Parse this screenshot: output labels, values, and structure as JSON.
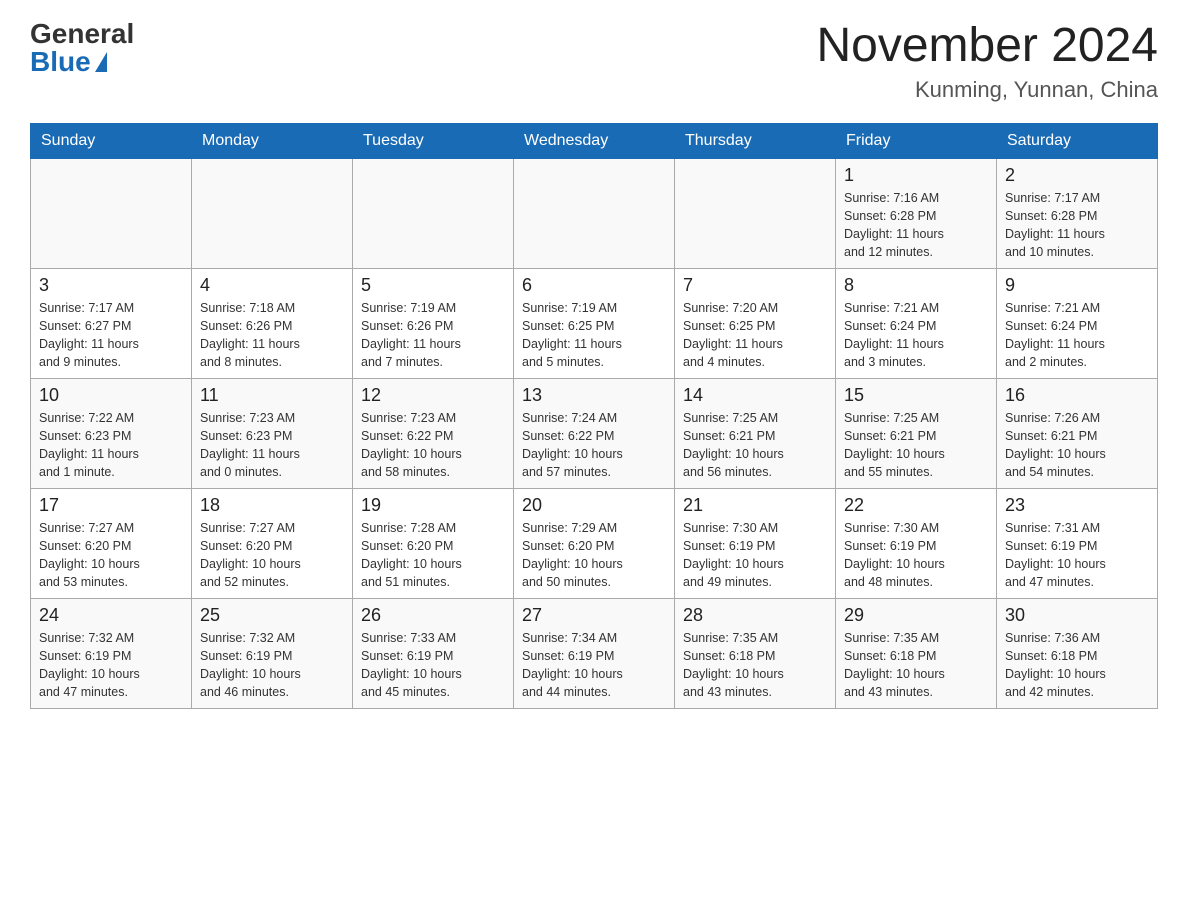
{
  "header": {
    "logo_general": "General",
    "logo_blue": "Blue",
    "month_title": "November 2024",
    "location": "Kunming, Yunnan, China"
  },
  "days_of_week": [
    "Sunday",
    "Monday",
    "Tuesday",
    "Wednesday",
    "Thursday",
    "Friday",
    "Saturday"
  ],
  "weeks": [
    [
      {
        "day": "",
        "info": ""
      },
      {
        "day": "",
        "info": ""
      },
      {
        "day": "",
        "info": ""
      },
      {
        "day": "",
        "info": ""
      },
      {
        "day": "",
        "info": ""
      },
      {
        "day": "1",
        "info": "Sunrise: 7:16 AM\nSunset: 6:28 PM\nDaylight: 11 hours\nand 12 minutes."
      },
      {
        "day": "2",
        "info": "Sunrise: 7:17 AM\nSunset: 6:28 PM\nDaylight: 11 hours\nand 10 minutes."
      }
    ],
    [
      {
        "day": "3",
        "info": "Sunrise: 7:17 AM\nSunset: 6:27 PM\nDaylight: 11 hours\nand 9 minutes."
      },
      {
        "day": "4",
        "info": "Sunrise: 7:18 AM\nSunset: 6:26 PM\nDaylight: 11 hours\nand 8 minutes."
      },
      {
        "day": "5",
        "info": "Sunrise: 7:19 AM\nSunset: 6:26 PM\nDaylight: 11 hours\nand 7 minutes."
      },
      {
        "day": "6",
        "info": "Sunrise: 7:19 AM\nSunset: 6:25 PM\nDaylight: 11 hours\nand 5 minutes."
      },
      {
        "day": "7",
        "info": "Sunrise: 7:20 AM\nSunset: 6:25 PM\nDaylight: 11 hours\nand 4 minutes."
      },
      {
        "day": "8",
        "info": "Sunrise: 7:21 AM\nSunset: 6:24 PM\nDaylight: 11 hours\nand 3 minutes."
      },
      {
        "day": "9",
        "info": "Sunrise: 7:21 AM\nSunset: 6:24 PM\nDaylight: 11 hours\nand 2 minutes."
      }
    ],
    [
      {
        "day": "10",
        "info": "Sunrise: 7:22 AM\nSunset: 6:23 PM\nDaylight: 11 hours\nand 1 minute."
      },
      {
        "day": "11",
        "info": "Sunrise: 7:23 AM\nSunset: 6:23 PM\nDaylight: 11 hours\nand 0 minutes."
      },
      {
        "day": "12",
        "info": "Sunrise: 7:23 AM\nSunset: 6:22 PM\nDaylight: 10 hours\nand 58 minutes."
      },
      {
        "day": "13",
        "info": "Sunrise: 7:24 AM\nSunset: 6:22 PM\nDaylight: 10 hours\nand 57 minutes."
      },
      {
        "day": "14",
        "info": "Sunrise: 7:25 AM\nSunset: 6:21 PM\nDaylight: 10 hours\nand 56 minutes."
      },
      {
        "day": "15",
        "info": "Sunrise: 7:25 AM\nSunset: 6:21 PM\nDaylight: 10 hours\nand 55 minutes."
      },
      {
        "day": "16",
        "info": "Sunrise: 7:26 AM\nSunset: 6:21 PM\nDaylight: 10 hours\nand 54 minutes."
      }
    ],
    [
      {
        "day": "17",
        "info": "Sunrise: 7:27 AM\nSunset: 6:20 PM\nDaylight: 10 hours\nand 53 minutes."
      },
      {
        "day": "18",
        "info": "Sunrise: 7:27 AM\nSunset: 6:20 PM\nDaylight: 10 hours\nand 52 minutes."
      },
      {
        "day": "19",
        "info": "Sunrise: 7:28 AM\nSunset: 6:20 PM\nDaylight: 10 hours\nand 51 minutes."
      },
      {
        "day": "20",
        "info": "Sunrise: 7:29 AM\nSunset: 6:20 PM\nDaylight: 10 hours\nand 50 minutes."
      },
      {
        "day": "21",
        "info": "Sunrise: 7:30 AM\nSunset: 6:19 PM\nDaylight: 10 hours\nand 49 minutes."
      },
      {
        "day": "22",
        "info": "Sunrise: 7:30 AM\nSunset: 6:19 PM\nDaylight: 10 hours\nand 48 minutes."
      },
      {
        "day": "23",
        "info": "Sunrise: 7:31 AM\nSunset: 6:19 PM\nDaylight: 10 hours\nand 47 minutes."
      }
    ],
    [
      {
        "day": "24",
        "info": "Sunrise: 7:32 AM\nSunset: 6:19 PM\nDaylight: 10 hours\nand 47 minutes."
      },
      {
        "day": "25",
        "info": "Sunrise: 7:32 AM\nSunset: 6:19 PM\nDaylight: 10 hours\nand 46 minutes."
      },
      {
        "day": "26",
        "info": "Sunrise: 7:33 AM\nSunset: 6:19 PM\nDaylight: 10 hours\nand 45 minutes."
      },
      {
        "day": "27",
        "info": "Sunrise: 7:34 AM\nSunset: 6:19 PM\nDaylight: 10 hours\nand 44 minutes."
      },
      {
        "day": "28",
        "info": "Sunrise: 7:35 AM\nSunset: 6:18 PM\nDaylight: 10 hours\nand 43 minutes."
      },
      {
        "day": "29",
        "info": "Sunrise: 7:35 AM\nSunset: 6:18 PM\nDaylight: 10 hours\nand 43 minutes."
      },
      {
        "day": "30",
        "info": "Sunrise: 7:36 AM\nSunset: 6:18 PM\nDaylight: 10 hours\nand 42 minutes."
      }
    ]
  ]
}
